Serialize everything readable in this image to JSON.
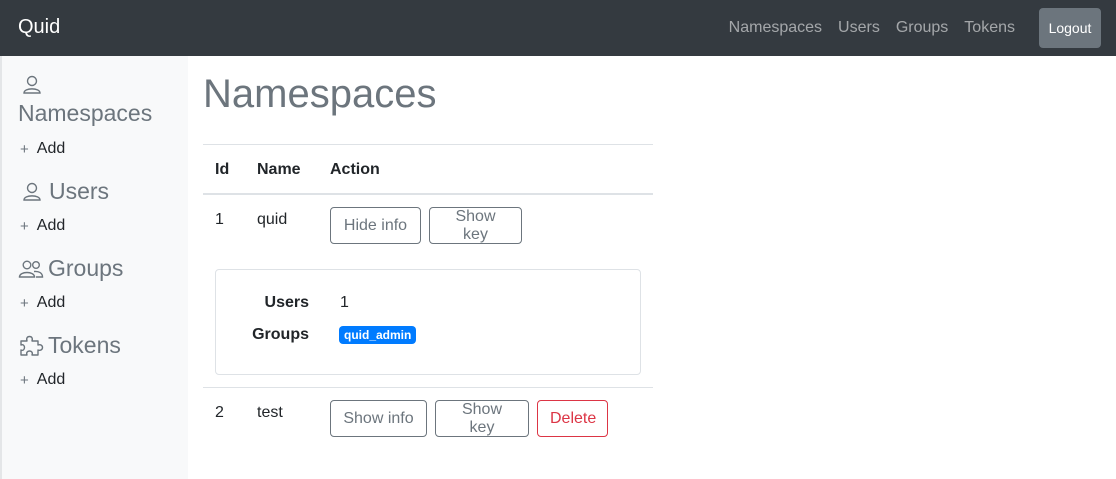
{
  "navbar": {
    "brand": "Quid",
    "links": [
      "Namespaces",
      "Users",
      "Groups",
      "Tokens"
    ],
    "logout": "Logout"
  },
  "sidebar": {
    "sections": [
      {
        "title": "Namespaces",
        "icon": "person-icon",
        "add": "Add"
      },
      {
        "title": "Users",
        "icon": "person-icon",
        "add": "Add"
      },
      {
        "title": "Groups",
        "icon": "people-icon",
        "add": "Add"
      },
      {
        "title": "Tokens",
        "icon": "puzzle-icon",
        "add": "Add"
      }
    ]
  },
  "main": {
    "title": "Namespaces",
    "table": {
      "headers": [
        "Id",
        "Name",
        "Action"
      ],
      "rows": [
        {
          "id": "1",
          "name": "quid",
          "actions": [
            "Hide info",
            "Show key"
          ],
          "info": {
            "users_label": "Users",
            "users_value": "1",
            "groups_label": "Groups",
            "groups": [
              "quid_admin"
            ]
          }
        },
        {
          "id": "2",
          "name": "test",
          "actions": [
            "Show info",
            "Show key",
            "Delete"
          ]
        }
      ]
    }
  },
  "colors": {
    "navbar_bg": "#343a40",
    "badge": "#007bff",
    "danger": "#dc3545",
    "muted": "#6c757d"
  }
}
